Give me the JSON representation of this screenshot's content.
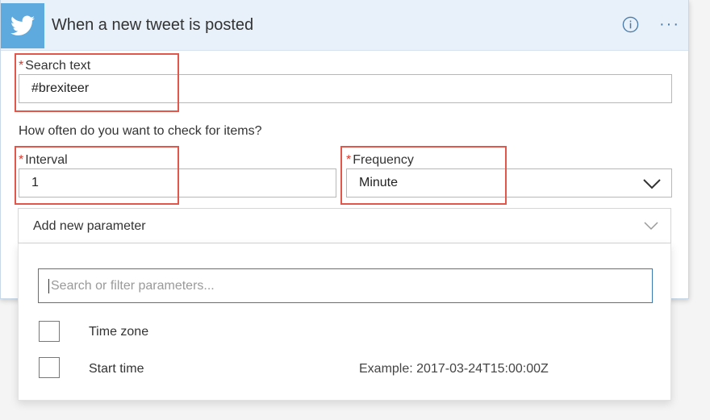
{
  "header": {
    "title": "When a new tweet is posted",
    "logo_icon": "twitter-bird-icon",
    "info_icon": "info-icon",
    "more_label": "···"
  },
  "search_text": {
    "required_mark": "*",
    "label": "Search text",
    "value": "#brexiteer"
  },
  "schedule": {
    "question": "How often do you want to check for items?",
    "interval": {
      "required_mark": "*",
      "label": "Interval",
      "value": "1"
    },
    "frequency": {
      "required_mark": "*",
      "label": "Frequency",
      "value": "Minute"
    }
  },
  "add_parameter": {
    "label": "Add new parameter",
    "search_placeholder": "Search or filter parameters...",
    "options": [
      {
        "label": "Time zone",
        "checked": false
      },
      {
        "label": "Start time",
        "checked": false,
        "hint": "Example: 2017-03-24T15:00:00Z"
      }
    ]
  },
  "colors": {
    "header_bg": "#e8f1fa",
    "logo_bg": "#5ea9dd",
    "required": "#d43b2f",
    "highlight": "#e2574c",
    "focus_border": "#3b79b5"
  }
}
